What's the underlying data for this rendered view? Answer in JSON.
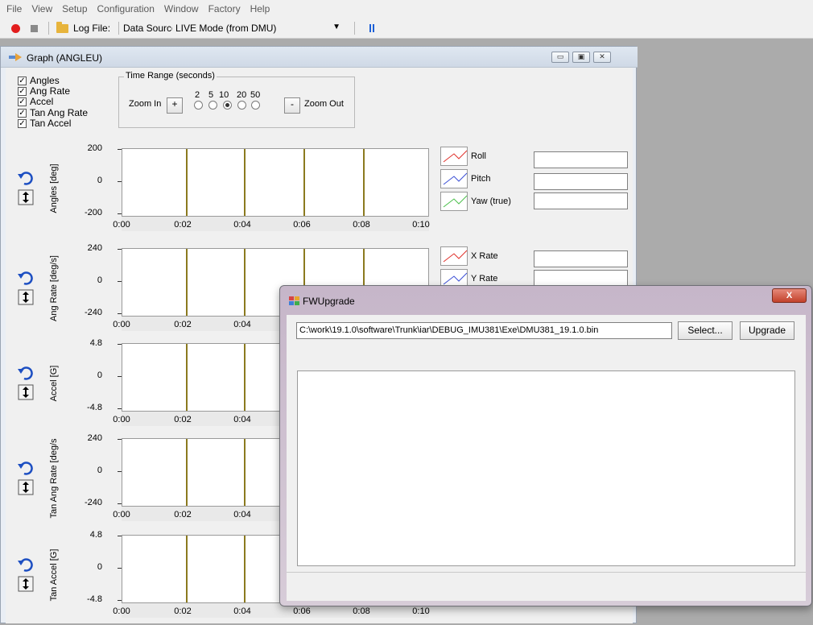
{
  "menu": [
    "File",
    "View",
    "Setup",
    "Configuration",
    "Window",
    "Factory",
    "Help"
  ],
  "toolbar": {
    "log_file_label": "Log File:",
    "data_source_label": "Data Source:",
    "data_source_value": "LIVE Mode (from DMU)",
    "colors": {
      "record": "#e21d1d",
      "pause": "#1b5fd7"
    }
  },
  "graph_window": {
    "title": "Graph (ANGLEU)",
    "checkboxes": [
      "Angles",
      "Ang Rate",
      "Accel",
      "Tan Ang Rate",
      "Tan Accel"
    ],
    "time_range": {
      "legend": "Time Range (seconds)",
      "zoom_in": "Zoom In",
      "zoom_out": "Zoom Out",
      "plus": "+",
      "minus": "-",
      "options": [
        "2",
        "5",
        "10",
        "20",
        "50"
      ],
      "selected_index": 2
    },
    "panels": [
      {
        "ylabel": "Angles [deg]",
        "yticks": [
          "200",
          "0",
          "-200"
        ],
        "xticks": [
          "0:00",
          "0:02",
          "0:04",
          "0:06",
          "0:08",
          "0:10"
        ]
      },
      {
        "ylabel": "Ang Rate [deg/s]",
        "yticks": [
          "240",
          "0",
          "-240"
        ],
        "xticks": [
          "0:00",
          "0:02",
          "0:04"
        ]
      },
      {
        "ylabel": "Accel [G]",
        "yticks": [
          "4.8",
          "0",
          "-4.8"
        ],
        "xticks": [
          "0:00",
          "0:02",
          "0:04"
        ]
      },
      {
        "ylabel": "Tan Ang Rate [deg/s",
        "yticks": [
          "240",
          "0",
          "-240"
        ],
        "xticks": [
          "0:00",
          "0:02",
          "0:04"
        ]
      },
      {
        "ylabel": "Tan Accel [G]",
        "yticks": [
          "4.8",
          "0",
          "-4.8"
        ],
        "xticks": [
          "0:00",
          "0:02",
          "0:04",
          "0:06",
          "0:08",
          "0:10"
        ]
      }
    ],
    "legend_angles": [
      {
        "label": "Roll",
        "color": "#e0312b"
      },
      {
        "label": "Pitch",
        "color": "#3b4fd6"
      },
      {
        "label": "Yaw (true)",
        "color": "#4cc04c"
      }
    ],
    "legend_rates": [
      {
        "label": "X Rate",
        "color": "#e0312b"
      },
      {
        "label": "Y Rate",
        "color": "#3b4fd6"
      }
    ]
  },
  "fw_dialog": {
    "title": "FWUpgrade",
    "close_label": "X",
    "file_path": "C:\\work\\19.1.0\\software\\Trunk\\iar\\DEBUG_IMU381\\Exe\\DMU381_19.1.0.bin",
    "select_button": "Select...",
    "upgrade_button": "Upgrade"
  }
}
